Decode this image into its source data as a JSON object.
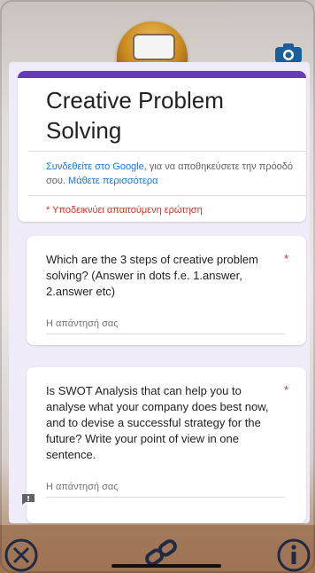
{
  "form": {
    "title": "Creative Problem Solving",
    "signin": {
      "link_text": "Συνδεθείτε στο Google",
      "middle_text": ", για να αποθηκεύσετε την πρόοδό σου. ",
      "learn_more": "Μάθετε περισσότερα"
    },
    "required_note": "* Υποδεικνύει απαιτούμενη ερώτηση",
    "accent_color": "#673ab7",
    "background_color": "#f0ebf8"
  },
  "questions": [
    {
      "text": "Which are the 3 steps of creative problem solving? (Answer in dots f.e. 1.answer, 2.answer etc)",
      "required_mark": "*",
      "placeholder": "Η απάντησή σας"
    },
    {
      "text": "Is SWOT Analysis that can help you to analyse what your company does best now, and to devise a successful strategy for the future? Write your point of view in one sentence.",
      "required_mark": "*",
      "placeholder": "Η απάντησή σας"
    }
  ],
  "overlay": {
    "top_right_icon": "camera-switch-icon",
    "feedback_icon": "report-feedback-icon",
    "bottom_bar_icons": [
      "close-circle-icon",
      "link-icon",
      "info-circle-icon"
    ]
  },
  "colors": {
    "required": "#d93025",
    "link": "#1a73e8",
    "bottom_bar": "#9e7254"
  }
}
